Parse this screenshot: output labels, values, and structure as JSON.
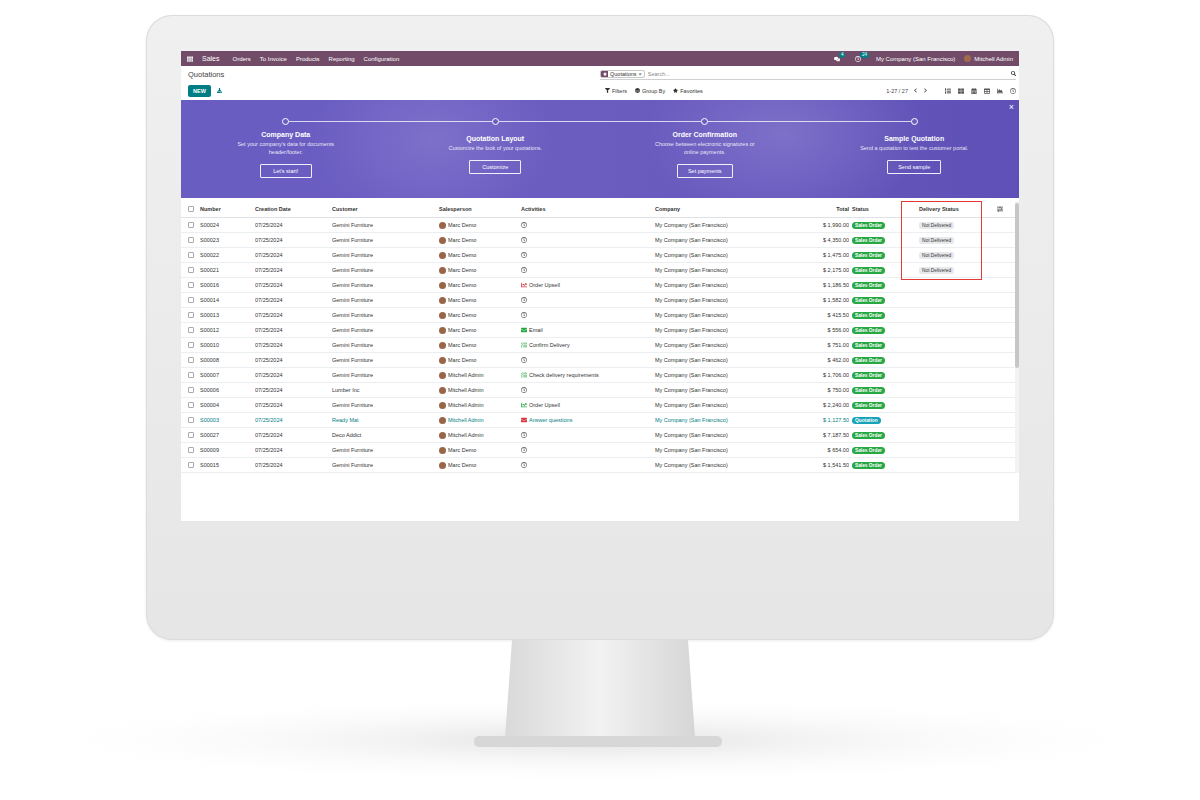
{
  "navbar": {
    "app": "Sales",
    "menu": [
      "Orders",
      "To Invoice",
      "Products",
      "Reporting",
      "Configuration"
    ],
    "messages_badge": "4",
    "activities_badge": "24",
    "company": "My Company (San Francisco)",
    "user": "Mitchell Admin"
  },
  "control_panel": {
    "title": "Quotations",
    "new_button": "NEW",
    "search": {
      "facet": "Quotations",
      "facet_remove": "×",
      "placeholder": "Search..."
    },
    "filters": [
      {
        "label": "Filters",
        "kind": "filter"
      },
      {
        "label": "Group By",
        "kind": "group"
      },
      {
        "label": "Favorites",
        "kind": "favorite"
      }
    ],
    "pager": "1-27 / 27",
    "views": [
      {
        "kind": "list",
        "selected": true
      },
      {
        "kind": "kanban",
        "selected": false
      },
      {
        "kind": "calendar",
        "selected": false
      },
      {
        "kind": "pivot",
        "selected": false
      },
      {
        "kind": "graph",
        "selected": false
      },
      {
        "kind": "activity",
        "selected": false
      }
    ]
  },
  "onboarding": {
    "close": "×",
    "steps": [
      {
        "title": "Company Data",
        "description": "Set your company's data for documents header/footer.",
        "button": "Let's start!"
      },
      {
        "title": "Quotation Layout",
        "description": "Customize the look of your quotations.",
        "button": "Customize"
      },
      {
        "title": "Order Confirmation",
        "description": "Choose between electronic signatures or online payments.",
        "button": "Set payments"
      },
      {
        "title": "Sample Quotation",
        "description": "Send a quotation to test the customer portal.",
        "button": "Send sample"
      }
    ]
  },
  "table": {
    "select_all": {
      "checked": false
    },
    "columns": [
      {
        "label": "Number",
        "highlighted": false
      },
      {
        "label": "Creation Date",
        "highlighted": false
      },
      {
        "label": "Customer",
        "highlighted": false
      },
      {
        "label": "Salesperson",
        "highlighted": false
      },
      {
        "label": "Activities",
        "highlighted": false
      },
      {
        "label": "Company",
        "highlighted": false
      },
      {
        "label": "Total",
        "highlighted": false
      },
      {
        "label": "Status",
        "highlighted": false
      },
      {
        "label": "Delivery Status",
        "highlighted": true
      }
    ],
    "rows": [
      {
        "number": "S00024",
        "date": "07/25/2024",
        "customer": "Gemini Furniture",
        "salesperson": "Marc Demo",
        "activity": {
          "kind": "none",
          "label": "",
          "color": "#555555"
        },
        "company": "My Company (San Francisco)",
        "total": "$ 1,990.00",
        "status": {
          "label": "Sales Order",
          "color": "#28a745"
        },
        "delivery": "Not Delivered",
        "selected": false,
        "hovered": false
      },
      {
        "number": "S00023",
        "date": "07/25/2024",
        "customer": "Gemini Furniture",
        "salesperson": "Marc Demo",
        "activity": {
          "kind": "none",
          "label": "",
          "color": "#555555"
        },
        "company": "My Company (San Francisco)",
        "total": "$ 4,350.00",
        "status": {
          "label": "Sales Order",
          "color": "#28a745"
        },
        "delivery": "Not Delivered",
        "selected": false,
        "hovered": false
      },
      {
        "number": "S00022",
        "date": "07/25/2024",
        "customer": "Gemini Furniture",
        "salesperson": "Marc Demo",
        "activity": {
          "kind": "none",
          "label": "",
          "color": "#555555"
        },
        "company": "My Company (San Francisco)",
        "total": "$ 1,475.00",
        "status": {
          "label": "Sales Order",
          "color": "#28a745"
        },
        "delivery": "Not Delivered",
        "selected": false,
        "hovered": false
      },
      {
        "number": "S00021",
        "date": "07/25/2024",
        "customer": "Gemini Furniture",
        "salesperson": "Marc Demo",
        "activity": {
          "kind": "none",
          "label": "",
          "color": "#555555"
        },
        "company": "My Company (San Francisco)",
        "total": "$ 2,175.00",
        "status": {
          "label": "Sales Order",
          "color": "#28a745"
        },
        "delivery": "Not Delivered",
        "selected": false,
        "hovered": false
      },
      {
        "number": "S00016",
        "date": "07/25/2024",
        "customer": "Gemini Furniture",
        "salesperson": "Marc Demo",
        "activity": {
          "kind": "upsell",
          "label": "Order Upsell",
          "color": "#d9363e"
        },
        "company": "My Company (San Francisco)",
        "total": "$ 1,186.50",
        "status": {
          "label": "Sales Order",
          "color": "#28a745"
        },
        "delivery": "",
        "selected": false,
        "hovered": false
      },
      {
        "number": "S00014",
        "date": "07/25/2024",
        "customer": "Gemini Furniture",
        "salesperson": "Marc Demo",
        "activity": {
          "kind": "none",
          "label": "",
          "color": "#555555"
        },
        "company": "My Company (San Francisco)",
        "total": "$ 1,582.00",
        "status": {
          "label": "Sales Order",
          "color": "#28a745"
        },
        "delivery": "",
        "selected": false,
        "hovered": false
      },
      {
        "number": "S00013",
        "date": "07/25/2024",
        "customer": "Gemini Furniture",
        "salesperson": "Marc Demo",
        "activity": {
          "kind": "none",
          "label": "",
          "color": "#555555"
        },
        "company": "My Company (San Francisco)",
        "total": "$ 415.50",
        "status": {
          "label": "Sales Order",
          "color": "#28a745"
        },
        "delivery": "",
        "selected": false,
        "hovered": false
      },
      {
        "number": "S00012",
        "date": "07/25/2024",
        "customer": "Gemini Furniture",
        "salesperson": "Marc Demo",
        "activity": {
          "kind": "email",
          "label": "Email",
          "color": "#28a745"
        },
        "company": "My Company (San Francisco)",
        "total": "$ 556.00",
        "status": {
          "label": "Sales Order",
          "color": "#28a745"
        },
        "delivery": "",
        "selected": false,
        "hovered": false
      },
      {
        "number": "S00010",
        "date": "07/25/2024",
        "customer": "Gemini Furniture",
        "salesperson": "Marc Demo",
        "activity": {
          "kind": "todo",
          "label": "Confirm Delivery",
          "color": "#28a745"
        },
        "company": "My Company (San Francisco)",
        "total": "$ 751.00",
        "status": {
          "label": "Sales Order",
          "color": "#28a745"
        },
        "delivery": "",
        "selected": false,
        "hovered": false
      },
      {
        "number": "S00008",
        "date": "07/25/2024",
        "customer": "Gemini Furniture",
        "salesperson": "Marc Demo",
        "activity": {
          "kind": "none",
          "label": "",
          "color": "#555555"
        },
        "company": "My Company (San Francisco)",
        "total": "$ 462.00",
        "status": {
          "label": "Sales Order",
          "color": "#28a745"
        },
        "delivery": "",
        "selected": false,
        "hovered": false
      },
      {
        "number": "S00007",
        "date": "07/25/2024",
        "customer": "Gemini Furniture",
        "salesperson": "Mitchell Admin",
        "activity": {
          "kind": "todo",
          "label": "Check delivery requirements",
          "color": "#28a745"
        },
        "company": "My Company (San Francisco)",
        "total": "$ 1,706.00",
        "status": {
          "label": "Sales Order",
          "color": "#28a745"
        },
        "delivery": "",
        "selected": false,
        "hovered": false
      },
      {
        "number": "S00006",
        "date": "07/25/2024",
        "customer": "Lumber Inc",
        "salesperson": "Mitchell Admin",
        "activity": {
          "kind": "none",
          "label": "",
          "color": "#555555"
        },
        "company": "My Company (San Francisco)",
        "total": "$ 750.00",
        "status": {
          "label": "Sales Order",
          "color": "#28a745"
        },
        "delivery": "",
        "selected": false,
        "hovered": false
      },
      {
        "number": "S00004",
        "date": "07/25/2024",
        "customer": "Gemini Furniture",
        "salesperson": "Mitchell Admin",
        "activity": {
          "kind": "upsell",
          "label": "Order Upsell",
          "color": "#28a745"
        },
        "company": "My Company (San Francisco)",
        "total": "$ 2,240.00",
        "status": {
          "label": "Sales Order",
          "color": "#28a745"
        },
        "delivery": "",
        "selected": false,
        "hovered": false
      },
      {
        "number": "S00003",
        "date": "07/25/2024",
        "customer": "Ready Mat",
        "salesperson": "Mitchell Admin",
        "activity": {
          "kind": "email",
          "label": "Answer questions",
          "color": "#d9363e"
        },
        "company": "My Company (San Francisco)",
        "total": "$ 1,127.50",
        "status": {
          "label": "Quotation",
          "color": "#17a2b8"
        },
        "delivery": "",
        "selected": false,
        "hovered": true
      },
      {
        "number": "S00027",
        "date": "07/25/2024",
        "customer": "Deco Addict",
        "salesperson": "Mitchell Admin",
        "activity": {
          "kind": "none",
          "label": "",
          "color": "#555555"
        },
        "company": "My Company (San Francisco)",
        "total": "$ 7,187.50",
        "status": {
          "label": "Sales Order",
          "color": "#28a745"
        },
        "delivery": "",
        "selected": false,
        "hovered": false
      },
      {
        "number": "S00009",
        "date": "07/25/2024",
        "customer": "Gemini Furniture",
        "salesperson": "Marc Demo",
        "activity": {
          "kind": "none",
          "label": "",
          "color": "#555555"
        },
        "company": "My Company (San Francisco)",
        "total": "$ 654.00",
        "status": {
          "label": "Sales Order",
          "color": "#28a745"
        },
        "delivery": "",
        "selected": false,
        "hovered": false
      },
      {
        "number": "S00015",
        "date": "07/25/2024",
        "customer": "Gemini Furniture",
        "salesperson": "Marc Demo",
        "activity": {
          "kind": "none",
          "label": "",
          "color": "#555555"
        },
        "company": "My Company (San Francisco)",
        "total": "$ 1,541.50",
        "status": {
          "label": "Sales Order",
          "color": "#28a745"
        },
        "delivery": "",
        "selected": false,
        "hovered": false
      }
    ]
  }
}
